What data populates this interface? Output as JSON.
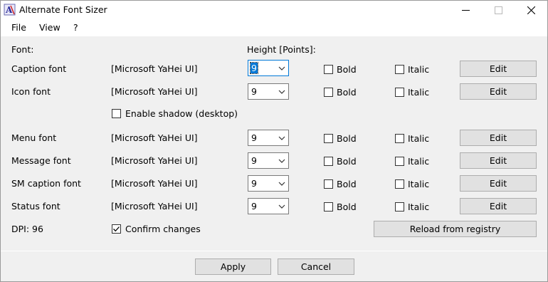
{
  "window": {
    "title": "Alternate Font Sizer"
  },
  "menu": {
    "items": [
      "File",
      "View",
      "?"
    ]
  },
  "header": {
    "font_label": "Font:",
    "height_label": "Height [Points]:"
  },
  "rows": [
    {
      "name": "Caption font",
      "font": "[Microsoft YaHei UI]",
      "size": "9",
      "bold": "Bold",
      "italic": "Italic",
      "edit": "Edit"
    },
    {
      "name": "Icon font",
      "font": "[Microsoft YaHei UI]",
      "size": "9",
      "bold": "Bold",
      "italic": "Italic",
      "edit": "Edit"
    },
    {
      "name": "Menu font",
      "font": "[Microsoft YaHei UI]",
      "size": "9",
      "bold": "Bold",
      "italic": "Italic",
      "edit": "Edit"
    },
    {
      "name": "Message font",
      "font": "[Microsoft YaHei UI]",
      "size": "9",
      "bold": "Bold",
      "italic": "Italic",
      "edit": "Edit"
    },
    {
      "name": "SM caption font",
      "font": "[Microsoft YaHei UI]",
      "size": "9",
      "bold": "Bold",
      "italic": "Italic",
      "edit": "Edit"
    },
    {
      "name": "Status font",
      "font": "[Microsoft YaHei UI]",
      "size": "9",
      "bold": "Bold",
      "italic": "Italic",
      "edit": "Edit"
    }
  ],
  "shadow": {
    "label": "Enable shadow (desktop)",
    "checked": false
  },
  "dpi": {
    "label": "DPI: 96"
  },
  "confirm": {
    "label": "Confirm changes",
    "checked": true
  },
  "reload_label": "Reload from registry",
  "footer": {
    "apply": "Apply",
    "cancel": "Cancel"
  },
  "icons": [
    "app-icon",
    "minimize-icon",
    "maximize-icon",
    "close-icon",
    "chevron-down-icon",
    "checkmark-icon"
  ]
}
